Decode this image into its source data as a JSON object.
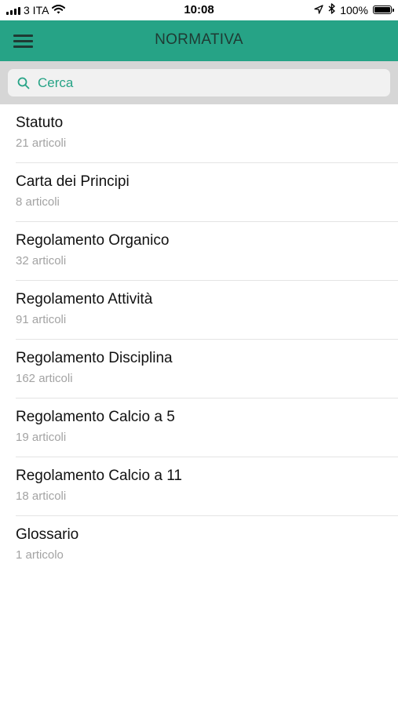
{
  "status_bar": {
    "carrier": "3 ITA",
    "time": "10:08",
    "battery": "100%",
    "battery_level": 1.0,
    "icons": [
      "signal-icon",
      "wifi-icon",
      "location-arrow-icon",
      "bluetooth-icon",
      "battery-icon"
    ]
  },
  "header": {
    "title": "NORMATIVA",
    "menu_icon": "hamburger-menu-icon",
    "background_color": "#26a386"
  },
  "search": {
    "placeholder": "Cerca",
    "value": "",
    "icon": "search-icon"
  },
  "list": {
    "items": [
      {
        "title": "Statuto",
        "subtitle": "21 articoli"
      },
      {
        "title": "Carta dei Principi",
        "subtitle": "8 articoli"
      },
      {
        "title": "Regolamento Organico",
        "subtitle": "32 articoli"
      },
      {
        "title": "Regolamento Attività",
        "subtitle": "91 articoli"
      },
      {
        "title": "Regolamento Disciplina",
        "subtitle": "162 articoli"
      },
      {
        "title": "Regolamento Calcio a 5",
        "subtitle": "19 articoli"
      },
      {
        "title": "Regolamento Calcio a 11",
        "subtitle": "18 articoli"
      },
      {
        "title": "Glossario",
        "subtitle": "1 articolo"
      }
    ]
  }
}
